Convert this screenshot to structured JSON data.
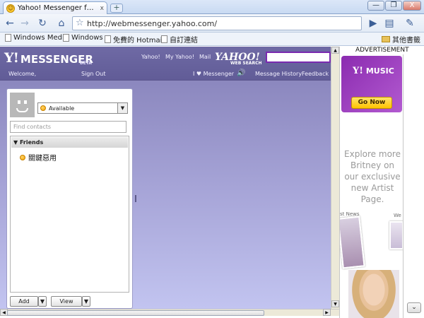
{
  "browser": {
    "tab_title": "Yahoo! Messenger for the ...",
    "tab_close": "x",
    "new_tab": "+",
    "url": "http://webmessenger.yahoo.com/",
    "window_buttons": {
      "minimize": "—",
      "restore": "❐",
      "close": "X"
    },
    "bookmarks": [
      {
        "label": "Windows Media"
      },
      {
        "label": "Windows"
      },
      {
        "label": "免費的 Hotmail"
      },
      {
        "label": "自訂連結"
      }
    ],
    "other_bookmarks": "其他書籤"
  },
  "header": {
    "logo_y": "Y!",
    "logo_text": "MESSENGER",
    "beta": "BETA",
    "links": {
      "yahoo": "Yahoo!",
      "my_yahoo": "My Yahoo!",
      "mail": "Mail"
    },
    "welcome": "Welcome,",
    "sign_out": "Sign Out",
    "love_messenger": "I ♥ Messenger",
    "message_history": "Message History",
    "feedback": "Feedback",
    "web_search_brand": "YAHOO!",
    "web_search_label": "WEB SEARCH"
  },
  "panel": {
    "status": "Available",
    "find_placeholder": "Find contacts",
    "group_name": "Friends",
    "friends": [
      {
        "name": "關鍵惡用"
      }
    ],
    "add_label": "Add",
    "view_label": "View"
  },
  "ad": {
    "label": "ADVERTISEMENT",
    "brand": "MUSIC",
    "cta": "Go Now",
    "copy": "Explore more Britney on our exclusive new Artist Page.",
    "news": "st News",
    "we": "We"
  },
  "colors": {
    "header_bg": "#6f6aa5",
    "page_bg_bottom": "#c2c4f0",
    "ad_purple": "#8b2bb0",
    "cta_yellow": "#ffc400"
  }
}
